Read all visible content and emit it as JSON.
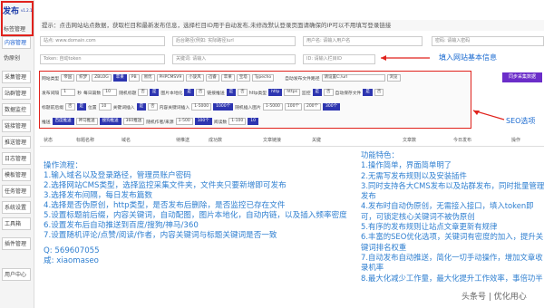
{
  "sidebar": {
    "logo": "发布",
    "version": "v1.2.1",
    "items": [
      {
        "label": "标签管理"
      },
      {
        "label": "内容管理"
      },
      {
        "label": "伪原创"
      },
      {
        "label": "采集管理"
      },
      {
        "label": "站群管理"
      },
      {
        "label": "数据监控"
      },
      {
        "label": "链接管理"
      },
      {
        "label": "推送管理"
      },
      {
        "label": "日志管理"
      },
      {
        "label": "模板管理"
      },
      {
        "label": "任务管理"
      },
      {
        "label": "系统设置"
      },
      {
        "label": "工具箱"
      },
      {
        "label": "插件管理"
      },
      {
        "label": "用户中心"
      }
    ]
  },
  "hint": "提示：点击网站站点数据，获取栏目和最新发布信息，选择栏目ID用于自动发布,未修改默认登录页面请确保的IP可以不用填写登录链接",
  "inputs": {
    "domain": "站点: www.domain.com",
    "cms_path": "后台路径(例如: 实际路径)url",
    "username": "用户名: 请输入用户名",
    "password": "密码: 请输入密码",
    "column": "分类: 请选择栏目",
    "token": "Token: 自动token",
    "keyword": "关键词: 请输入",
    "fields": "字段: 请选择字段",
    "col_id": "ID: 请输入栏目ID"
  },
  "annotations": {
    "basic": "填入网站基本信息",
    "seo": "SEO选项"
  },
  "seo": {
    "row1": {
      "label": "网站类型",
      "types": [
        "帝国",
        "织梦",
        "ZBLOG",
        "苹果",
        "PB",
        "易优",
        "PHPCMSV9",
        "小旋风",
        "迅睿",
        "苹果",
        "宝塔",
        "Typecho"
      ],
      "active_index": 3,
      "extra_label": "自动发布文件路径",
      "path_value": "请设置C:/url",
      "browse": "浏览"
    },
    "row2": {
      "label": "发布间隔",
      "interval": "1",
      "unit": "秒",
      "count_label": "每日篇数",
      "count": "10",
      "random_label": "随机标题",
      "random_opts": [
        "否",
        "是"
      ],
      "pic_label": "图片本地化",
      "pic_opts": [
        "是",
        "否"
      ],
      "rel_label": "链接推送",
      "rel_opts": [
        "是",
        "否"
      ],
      "http_label": "http类型",
      "http_opts": [
        "http",
        "https"
      ],
      "moni_label": "监控",
      "moni_opts": [
        "是",
        "否"
      ],
      "save_label": "自动保存文件",
      "save_opts": [
        "是",
        "否"
      ]
    },
    "row3": {
      "label": "标题前后缀",
      "opts": [
        "否",
        "是"
      ],
      "pos_label": "位置",
      "pos": "10",
      "kw_label": "关键词插入",
      "kw_opts": [
        "是",
        "否"
      ],
      "in_label": "内容关键词插入",
      "range1": "1-5000",
      "range2": "1000个",
      "inner_label": "随机插入图片",
      "range3": "1-5000",
      "range4": "100个",
      "range5": "200个",
      "range6": "300个"
    },
    "row4": {
      "label": "推送",
      "opts": [
        "百度推送",
        "神马推送",
        "搜狗推送",
        "360推送"
      ],
      "author_label": "随机作者/来源",
      "range1": "1-500",
      "range2": "100个",
      "read_label": "阅读数",
      "range3": "1-100",
      "range4": "10"
    },
    "publish_button": "同步采集数据"
  },
  "table": {
    "headers": [
      "状态",
      "标题名称",
      "域名",
      "待推送",
      "成功数",
      "文章链接",
      "关键",
      "文章数",
      "今日发布",
      "操作"
    ]
  },
  "steps": {
    "title": "操作流程：",
    "items": [
      "1.输入域名以及登录路径，管理员账户密码",
      "2.选择网站CMS类型，选择监控采集文件夹，文件夹只要新增即可发布",
      "3.选择发布间隔，每日发布篇数",
      "4.选择是否伪原创，http类型，是否发布后删除，是否监控已存在文件",
      "5.设置标题前后缀，内容关键词，自动配图，图片本地化，自动内链，以及插入频率密度",
      "6.设置发布后自动推送到百度/搜狗/神马/360",
      "7.设置随机评论/点赞/阅读/作者，内容关键词与标题关键词是否一致"
    ],
    "qq": "Q:  569607055",
    "wx": "咸:  xiaomaseo"
  },
  "features": {
    "title": "功能特色：",
    "items": [
      "1.操作简单，界面简单明了",
      "2.无需写发布规则以及安装插件",
      "3.同时支持各大CMS发布以及站群发布，同时批量管理",
      "发布",
      "4.发布时自动伪原创，无需接入接口，填入token即",
      "可，可锁定核心关键词不被伪原创",
      "5.有序的发布规则让站点文章更新有规律",
      "6.丰富的SEO优化选项，关键词有密度的加入，提升关",
      "键词排名权重",
      "7.自动发布自动推送，简化一切手动操作，增加文章收",
      "录机率",
      "8.最大化减少工作量，最大化提升工作效率，事倍功半"
    ]
  },
  "watermark": "头条号 | 优化用心"
}
